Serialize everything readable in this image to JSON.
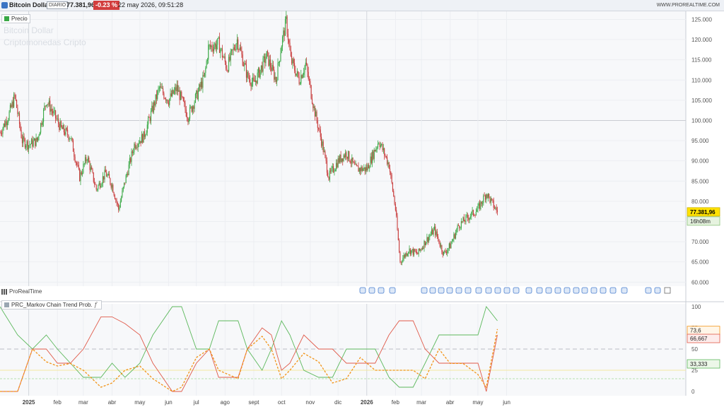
{
  "header": {
    "instrument": "Bitcoin Dollar",
    "period": "DIARIO",
    "price": "77.381,96",
    "change": "-0.23 %",
    "datetime": "22 may 2026, 09:51:28",
    "site": "WWW.PROREALTIME.COM"
  },
  "watermark": {
    "line1": "Bitcoin Dollar",
    "line2": "Criptomonedas  Cripto"
  },
  "price_legend": "Precio",
  "brand": "ProRealTime",
  "indicator_legend": "PRC_Markov Chain Trend Prob.",
  "indicator_fx": "f",
  "price_tag": {
    "value": "77.381,96",
    "countdown": "16h08m"
  },
  "indicator_tags": {
    "orange": "73,6",
    "red": "66,667",
    "green": "33,333"
  },
  "colors": {
    "up": "#39a845",
    "down": "#c83b3b",
    "orange": "#f29418",
    "green": "#5cb85c",
    "red": "#e05a4a",
    "accent_bg": "#ffe100"
  },
  "chart_data": [
    {
      "type": "candlestick",
      "title": "Bitcoin Dollar",
      "y_ticks": [
        "125.000",
        "120.000",
        "115.000",
        "110.000",
        "105.000",
        "100.000",
        "95.000",
        "90.000",
        "85.000",
        "80.000",
        "75.000",
        "70.000",
        "65.000",
        "60.000"
      ],
      "ylim": [
        59000,
        127000
      ],
      "x_ticks": [
        "2025",
        "feb",
        "mar",
        "abr",
        "may",
        "jun",
        "jul",
        "ago",
        "sept",
        "oct",
        "nov",
        "dic",
        "2026",
        "feb",
        "mar",
        "abr",
        "may",
        "jun"
      ],
      "close_path_approx": {
        "dates": [
          "2024-12-01",
          "2024-12-10",
          "2024-12-17",
          "2024-12-25",
          "2025-01-01",
          "2025-01-10",
          "2025-01-20",
          "2025-01-27",
          "2025-02-05",
          "2025-02-15",
          "2025-02-25",
          "2025-03-05",
          "2025-03-15",
          "2025-03-25",
          "2025-04-01",
          "2025-04-08",
          "2025-04-15",
          "2025-04-25",
          "2025-05-05",
          "2025-05-15",
          "2025-05-22",
          "2025-06-01",
          "2025-06-10",
          "2025-06-22",
          "2025-07-01",
          "2025-07-10",
          "2025-07-14",
          "2025-07-25",
          "2025-08-03",
          "2025-08-14",
          "2025-08-25",
          "2025-09-01",
          "2025-09-15",
          "2025-09-25",
          "2025-10-01",
          "2025-10-06",
          "2025-10-11",
          "2025-10-20",
          "2025-10-27",
          "2025-11-05",
          "2025-11-14",
          "2025-11-21",
          "2025-12-01",
          "2025-12-10",
          "2025-12-20",
          "2026-01-01",
          "2026-01-14",
          "2026-01-25",
          "2026-02-01",
          "2026-02-06",
          "2026-02-15",
          "2026-02-25",
          "2026-03-05",
          "2026-03-15",
          "2026-03-25",
          "2026-04-01",
          "2026-04-10",
          "2026-04-20",
          "2026-05-01",
          "2026-05-10",
          "2026-05-15",
          "2026-05-22"
        ],
        "values": [
          97000,
          101000,
          106000,
          95000,
          94000,
          95000,
          105000,
          102000,
          98000,
          96000,
          86000,
          91000,
          83000,
          87000,
          84000,
          78000,
          85000,
          94000,
          96000,
          103000,
          108000,
          105000,
          108000,
          101000,
          106000,
          111000,
          118000,
          119000,
          113000,
          120000,
          111000,
          109000,
          116000,
          110000,
          119000,
          124500,
          115000,
          110000,
          114000,
          103000,
          94000,
          86000,
          90000,
          92000,
          88000,
          88000,
          95000,
          89000,
          78000,
          65000,
          68000,
          67000,
          70000,
          73000,
          67000,
          69000,
          74000,
          76000,
          78000,
          82000,
          80000,
          77382
        ]
      }
    },
    {
      "type": "line",
      "title": "PRC_Markov Chain Trend Prob.",
      "ylim": [
        0,
        100
      ],
      "y_ticks": [
        "100",
        "75",
        "50",
        "25",
        "0"
      ],
      "levels": [
        50,
        25,
        15
      ],
      "x_ticks": [
        "2025",
        "feb",
        "mar",
        "abr",
        "may",
        "jun",
        "jul",
        "ago",
        "sept",
        "oct",
        "nov",
        "dic",
        "2026",
        "feb",
        "mar",
        "abr",
        "may",
        "jun"
      ],
      "series": [
        {
          "color": "green",
          "dates": [
            "2024-12-01",
            "2024-12-20",
            "2025-01-05",
            "2025-01-20",
            "2025-02-01",
            "2025-02-15",
            "2025-03-01",
            "2025-03-20",
            "2025-04-01",
            "2025-04-15",
            "2025-05-01",
            "2025-05-15",
            "2025-06-05",
            "2025-06-15",
            "2025-07-01",
            "2025-07-15",
            "2025-07-25",
            "2025-08-15",
            "2025-08-25",
            "2025-09-10",
            "2025-09-20",
            "2025-10-01",
            "2025-10-10",
            "2025-10-25",
            "2025-11-10",
            "2025-11-25",
            "2025-12-10",
            "2025-12-25",
            "2026-01-10",
            "2026-01-25",
            "2026-02-05",
            "2026-02-20",
            "2026-03-05",
            "2026-03-20",
            "2026-04-01",
            "2026-04-15",
            "2026-05-01",
            "2026-05-10",
            "2026-05-22"
          ],
          "values": [
            100,
            66.7,
            50,
            66.7,
            50,
            33.3,
            16.7,
            16.7,
            33.3,
            16.7,
            33.3,
            66.7,
            100,
            100,
            50,
            50,
            83.3,
            83.3,
            50,
            25,
            50,
            83.3,
            66.7,
            25,
            16.7,
            16.7,
            50,
            50,
            50,
            16.7,
            5,
            5,
            33.3,
            66.7,
            66.7,
            66.7,
            66.7,
            100,
            83.3
          ]
        },
        {
          "color": "red",
          "dates": [
            "2024-12-01",
            "2024-12-20",
            "2025-01-05",
            "2025-01-20",
            "2025-02-01",
            "2025-02-15",
            "2025-03-01",
            "2025-03-20",
            "2025-04-01",
            "2025-04-15",
            "2025-05-01",
            "2025-05-15",
            "2025-06-05",
            "2025-06-15",
            "2025-07-01",
            "2025-07-15",
            "2025-07-25",
            "2025-08-15",
            "2025-08-25",
            "2025-09-10",
            "2025-09-20",
            "2025-10-01",
            "2025-10-10",
            "2025-10-25",
            "2025-11-10",
            "2025-11-25",
            "2025-12-10",
            "2025-12-25",
            "2026-01-10",
            "2026-01-25",
            "2026-02-05",
            "2026-02-20",
            "2026-03-05",
            "2026-03-20",
            "2026-04-01",
            "2026-04-15",
            "2026-05-01",
            "2026-05-10",
            "2026-05-22"
          ],
          "values": [
            0,
            0,
            50,
            50,
            33.3,
            33.3,
            50,
            88,
            88,
            80,
            66.7,
            33.3,
            0,
            0,
            33.3,
            50,
            16.7,
            16.7,
            50,
            75,
            66.7,
            25,
            33.3,
            66.7,
            50,
            50,
            33.3,
            33.3,
            33.3,
            66.7,
            83.3,
            83.3,
            50,
            33.3,
            33.3,
            33.3,
            33.3,
            0,
            66.7
          ]
        },
        {
          "color": "orange",
          "dates": [
            "2024-12-01",
            "2024-12-20",
            "2025-01-05",
            "2025-01-20",
            "2025-02-01",
            "2025-02-15",
            "2025-03-01",
            "2025-03-20",
            "2025-04-01",
            "2025-04-15",
            "2025-05-01",
            "2025-05-15",
            "2025-06-05",
            "2025-06-15",
            "2025-07-01",
            "2025-07-15",
            "2025-07-25",
            "2025-08-15",
            "2025-08-25",
            "2025-09-10",
            "2025-09-20",
            "2025-10-01",
            "2025-10-10",
            "2025-10-25",
            "2025-11-10",
            "2025-11-25",
            "2025-12-10",
            "2025-12-25",
            "2026-01-10",
            "2026-01-25",
            "2026-02-05",
            "2026-02-20",
            "2026-03-05",
            "2026-03-20",
            "2026-04-01",
            "2026-04-15",
            "2026-05-01",
            "2026-05-10",
            "2026-05-22"
          ],
          "values": [
            0,
            0,
            50,
            35,
            30,
            33,
            25,
            5,
            10,
            25,
            30,
            15,
            0,
            5,
            40,
            50,
            25,
            15,
            50,
            65,
            50,
            15,
            25,
            45,
            35,
            10,
            15,
            40,
            25,
            25,
            25,
            25,
            15,
            50,
            33,
            33,
            20,
            5,
            73.6
          ]
        }
      ]
    }
  ]
}
